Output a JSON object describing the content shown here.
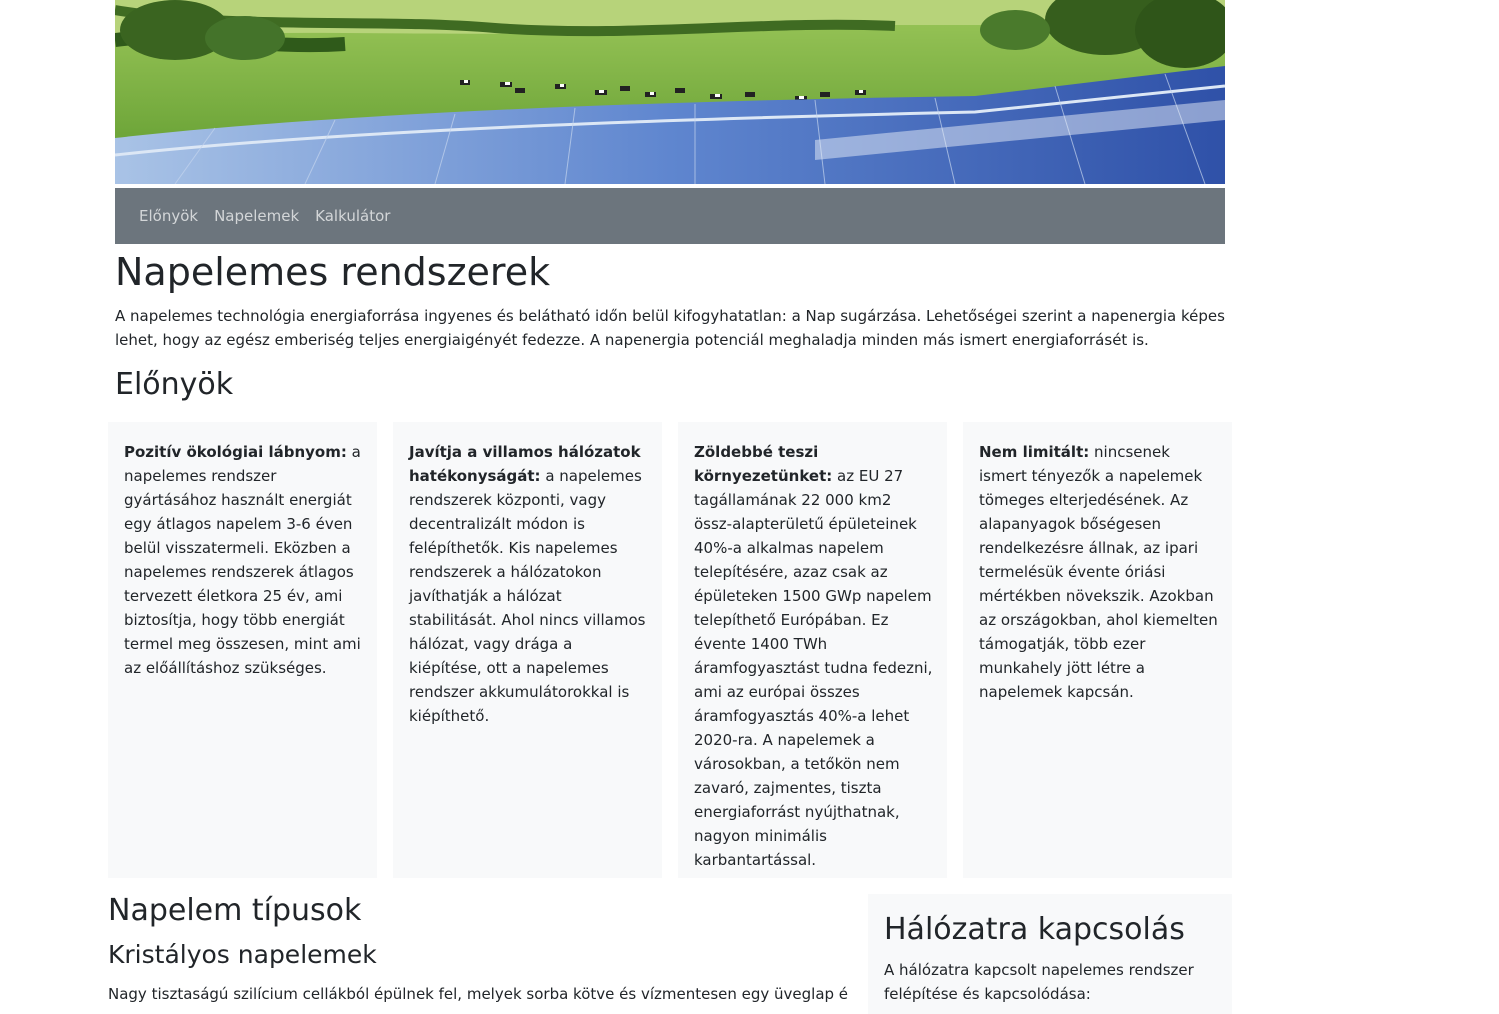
{
  "nav": {
    "items": [
      "Előnyök",
      "Napelemek",
      "Kalkulátor"
    ]
  },
  "main": {
    "title": "Napelemes rendszerek",
    "lead": "A napelemes technológia energiaforrása ingyenes és belátható időn belül kifogyhatatlan: a Nap sugárzása. Lehetőségei szerint a napenergia képes lehet, hogy az egész emberiség teljes energiaigényét fedezze. A napenergia potenciál meghaladja minden más ismert energiaforrásét is."
  },
  "benefits": {
    "heading": "Előnyök",
    "cards": [
      {
        "title": "Pozitív ökológiai lábnyom:",
        "text": " a napelemes rendszer gyártásához használt energiát egy átlagos napelem 3-6 éven belül visszatermeli. Eközben a napelemes rendszerek átlagos tervezett életkora 25 év, ami biztosítja, hogy több energiát termel meg összesen, mint ami az előállításhoz szükséges."
      },
      {
        "title": "Javítja a villamos hálózatok hatékonyságát:",
        "text": " a napelemes rendszerek központi, vagy decentralizált módon is felépíthetők. Kis napelemes rendszerek a hálózatokon javíthatják a hálózat stabilitását. Ahol nincs villamos hálózat, vagy drága a kiépítése, ott a napelemes rendszer akkumulátorokkal is kiépíthető."
      },
      {
        "title": "Zöldebbé teszi környezetünket:",
        "text": " az EU 27 tagállamának 22 000 km2 össz-alapterületű épületeinek 40%-a alkalmas napelem telepítésére, azaz csak az épületeken 1500 GWp napelem telepíthető Európában. Ez évente 1400 TWh áramfogyasztást tudna fedezni, ami az európai összes áramfogyasztás 40%-a lehet 2020-ra. A napelemek a városokban, a tetőkön nem zavaró, zajmentes, tiszta energiaforrást nyújthatnak, nagyon minimális karbantartással."
      },
      {
        "title": "Nem limitált:",
        "text": " nincsenek ismert tényezők a napelemek tömeges elterjedésének. Az alapanyagok bőségesen rendelkezésre állnak, az ipari termelésük évente óriási mértékben növekszik. Azokban az országokban, ahol kiemelten támogatják, több ezer munkahely jött létre a napelemek kapcsán."
      }
    ]
  },
  "types": {
    "heading": "Napelem típusok",
    "subheading": "Kristályos napelemek",
    "text": "Nagy tisztaságú szilícium cellákból épülnek fel, melyek sorba kötve és vízmentesen egy üveglap és egy"
  },
  "grid": {
    "heading": "Hálózatra kapcsolás",
    "text": "A hálózatra kapcsolt napelemes rendszer felépítése és kapcsolódása:"
  },
  "colors": {
    "navbar": "#6c757d",
    "card_bg": "#f8f9fa",
    "text": "#212529",
    "panel_blue": "#3b5fb8",
    "grass": "#6fa83a"
  }
}
